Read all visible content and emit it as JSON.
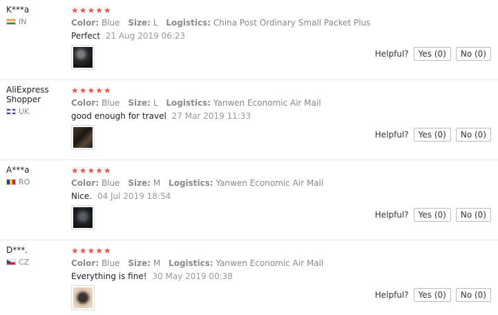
{
  "helpful_label": "Helpful?",
  "accent_star_color": "#e9564a",
  "reviews": [
    {
      "user": "K***a",
      "country": "IN",
      "stars": "★★★★★",
      "rating": 5,
      "color_label": "Color:",
      "color": "Blue",
      "size_label": "Size:",
      "size": "L",
      "logistics_label": "Logistics:",
      "logistics": "China Post Ordinary Small Packet Plus",
      "comment": "Perfect",
      "date": "21 Aug 2019 06:23",
      "yes": "Yes (0)",
      "no": "No (0)"
    },
    {
      "user": "AliExpress Shopper",
      "country": "UK",
      "stars": "★★★★★",
      "rating": 5,
      "color_label": "Color:",
      "color": "Blue",
      "size_label": "Size:",
      "size": "L",
      "logistics_label": "Logistics:",
      "logistics": "Yanwen Economic Air Mail",
      "comment": "good enough for travel",
      "date": "27 Mar 2019 11:33",
      "yes": "Yes (0)",
      "no": "No (0)"
    },
    {
      "user": "A***a",
      "country": "RO",
      "stars": "★★★★★",
      "rating": 5,
      "color_label": "Color:",
      "color": "Blue",
      "size_label": "Size:",
      "size": "M",
      "logistics_label": "Logistics:",
      "logistics": "Yanwen Economic Air Mail",
      "comment": "Nice.",
      "date": "04 Jul 2019 18:54",
      "yes": "Yes (0)",
      "no": "No (0)"
    },
    {
      "user": "D***.",
      "country": "CZ",
      "stars": "★★★★★",
      "rating": 5,
      "color_label": "Color:",
      "color": "Blue",
      "size_label": "Size:",
      "size": "M",
      "logistics_label": "Logistics:",
      "logistics": "Yanwen Economic Air Mail",
      "comment": "Everything is fine!",
      "date": "30 May 2019 00:38",
      "yes": "Yes (0)",
      "no": "No (0)"
    }
  ]
}
